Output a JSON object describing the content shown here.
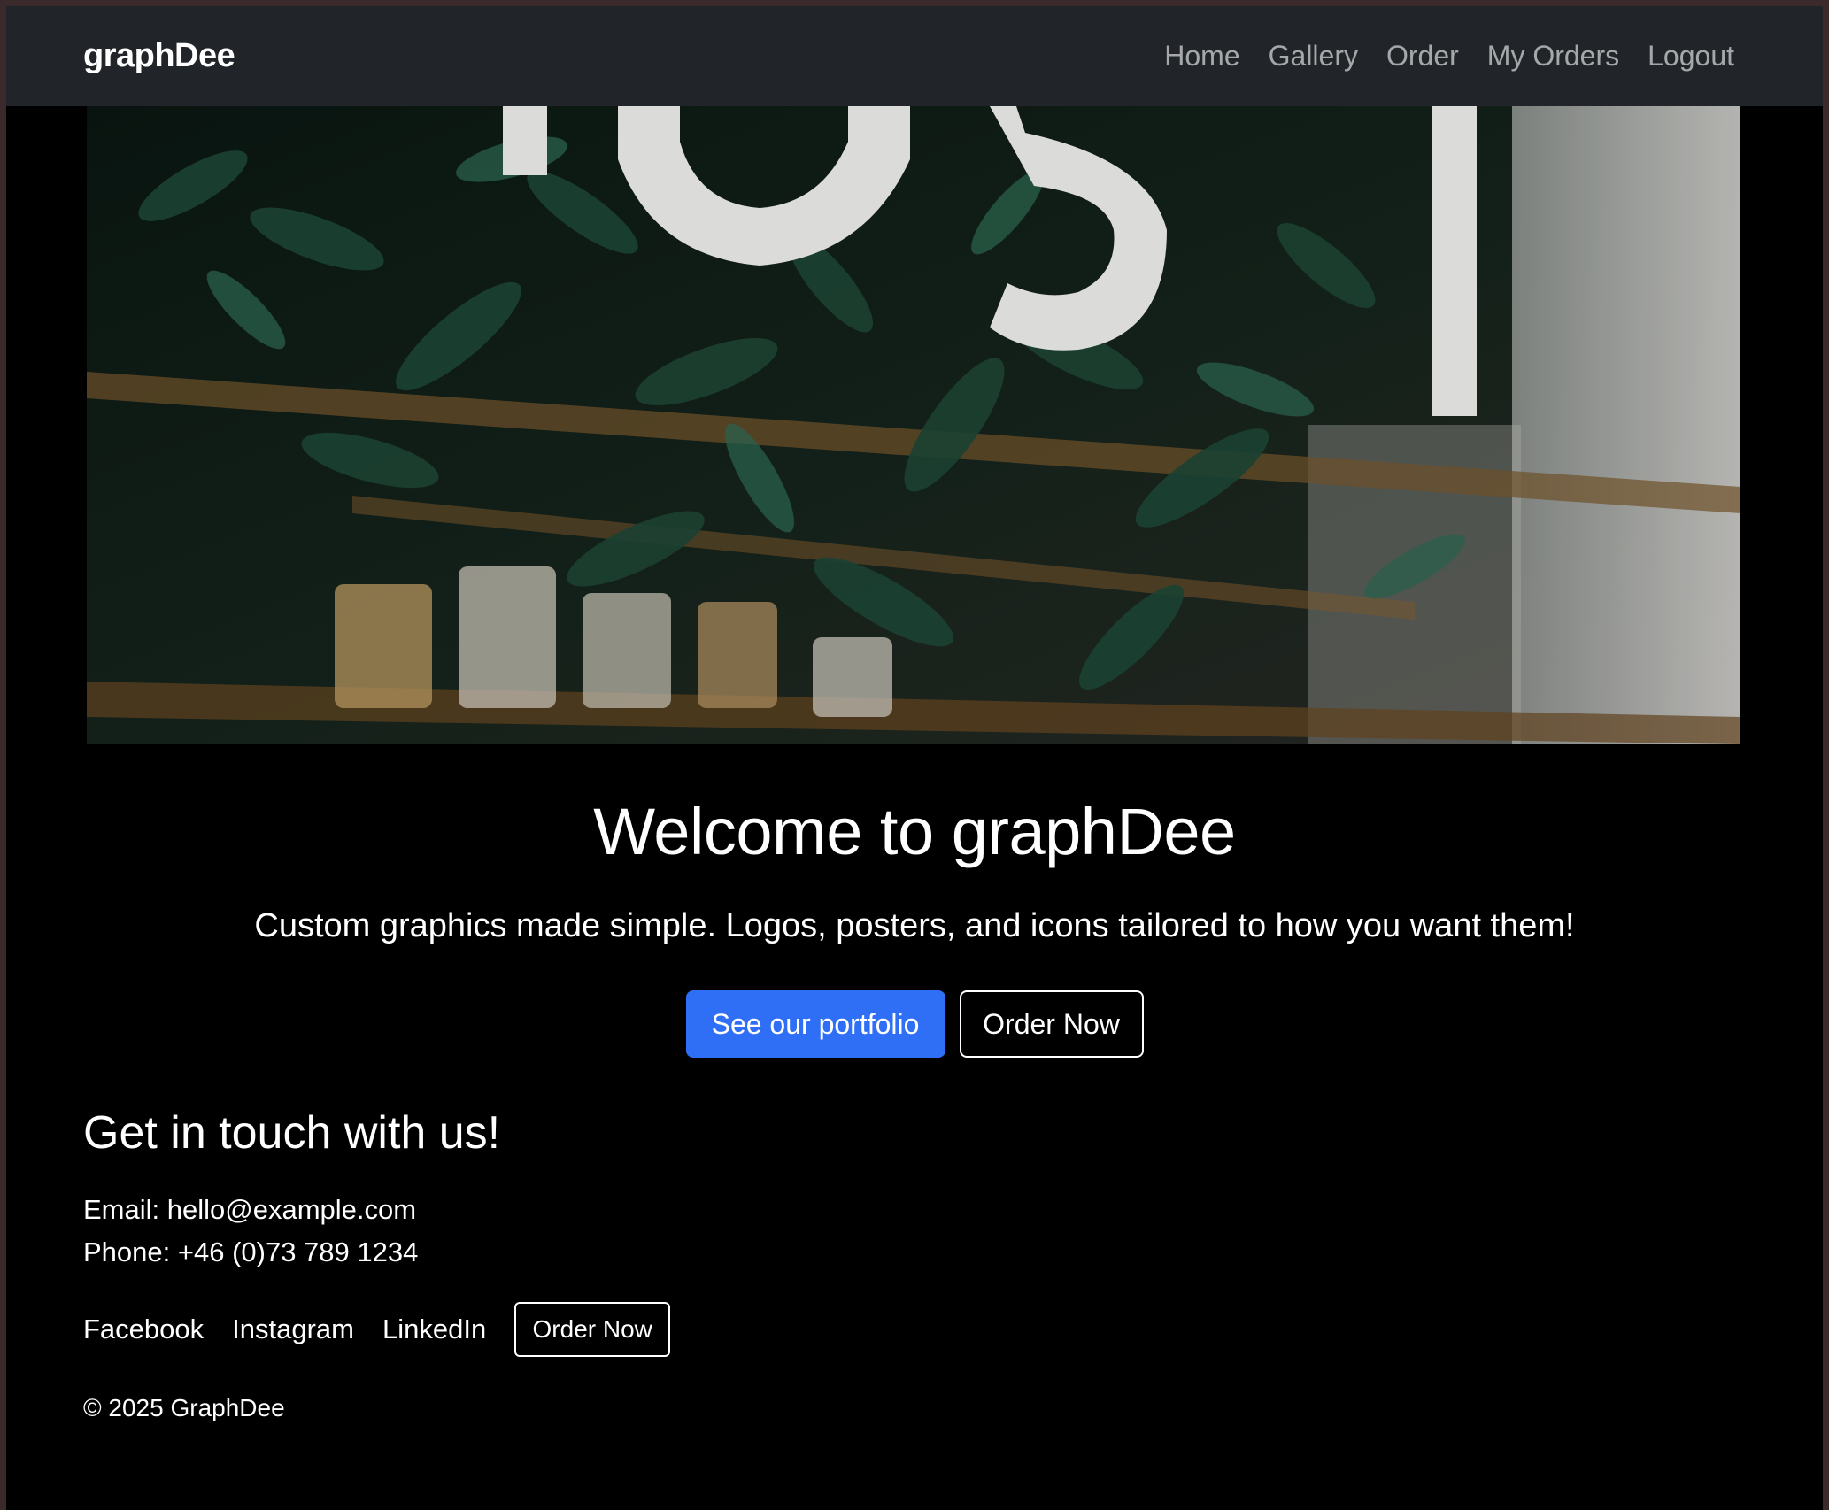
{
  "navbar": {
    "brand": "graphDee",
    "links": [
      "Home",
      "Gallery",
      "Order",
      "My Orders",
      "Logout"
    ]
  },
  "hero": {
    "title": "Welcome to graphDee",
    "subtitle": "Custom graphics made simple. Logos, posters, and icons tailored to how you want them!",
    "primary_button": "See our portfolio",
    "secondary_button": "Order Now"
  },
  "contact": {
    "heading": "Get in touch with us!",
    "email_line": "Email: hello@example.com",
    "phone_line": "Phone: +46 (0)73 789 1234",
    "social": [
      "Facebook",
      "Instagram",
      "LinkedIn"
    ],
    "order_button": "Order Now"
  },
  "footer": {
    "copyright": "© 2025 GraphDee"
  },
  "colors": {
    "navbar_bg": "#212529",
    "page_bg": "#000000",
    "primary": "#2f6ff5"
  }
}
